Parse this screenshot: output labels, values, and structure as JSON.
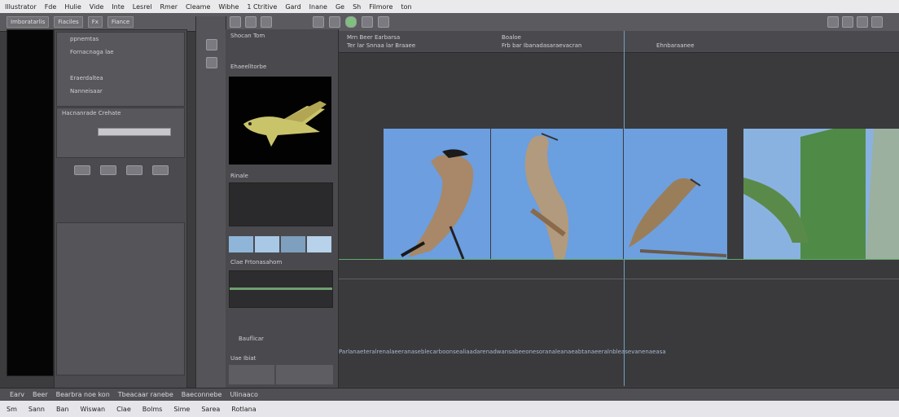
{
  "menubar": {
    "items": [
      "Illustrator",
      "Fde",
      "Hulie",
      "Vide",
      "Inte",
      "Lesrel",
      "Rmer",
      "Cleame",
      "Wibhe",
      "1 Ctritive",
      "Gard",
      "Inane",
      "Ge",
      "Sh",
      "Filmore",
      "ton"
    ]
  },
  "toolbar": {
    "left_label": "Imboratarlis",
    "file_label": "Fiaciles",
    "edit_label": "Fx",
    "view_label": "Fiance"
  },
  "left_panel": {
    "header": "ppnemtas",
    "rows": [
      "Fornacnaga lae",
      "Eraerdaltea",
      "Nanneisaar"
    ],
    "section_label": "Hacnanrade Crehate"
  },
  "thumb_panel": {
    "header": "Shocan Tom",
    "label1": "Ehaeelltorbe",
    "label2": "Rinale",
    "label3": "Clae Frtonasahom",
    "label4": "Bauflicar",
    "label5": "Uae Ibiat"
  },
  "timeline": {
    "ruler_left": "Mrn Beer Earbarsa",
    "ruler_left2": "Ter lar Snnaa lar Braaee",
    "ruler_mid": "Boaloe",
    "ruler_mid2": "Frb bar Ibanadasaraevacran",
    "ruler_right": "Ehnbaraanee",
    "track_text": "Parlanaeteralrenalaeeranaseblecarboonsealiaadarenadwansabeeonesoranaleanaeabtanaeeralnbleasevanenaeasa"
  },
  "statusbar": {
    "label": "Earv",
    "items": [
      "Beer",
      "Bearbra noe kon",
      "Tbeacaar ranebe",
      "Baeconnebe",
      "Ulinaaco"
    ]
  },
  "bottombar": {
    "items": [
      "Sm",
      "Sann",
      "Ban",
      "Wiswan",
      "Clae",
      "Bolms",
      "Sime",
      "Sarea",
      "Rotlana"
    ]
  }
}
